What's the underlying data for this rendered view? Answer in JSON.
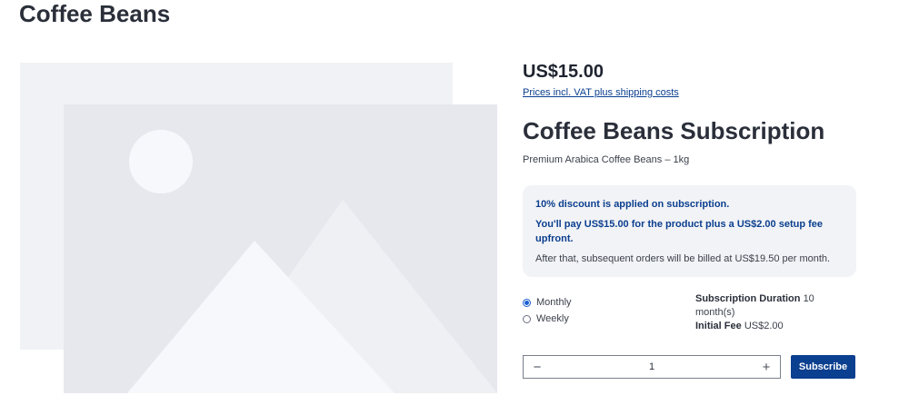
{
  "page": {
    "title": "Coffee Beans"
  },
  "product": {
    "price": "US$15.00",
    "tax_note": "Prices incl. VAT plus shipping costs",
    "name": "Coffee Beans Subscription",
    "short_description": "Premium Arabica Coffee Beans – 1kg"
  },
  "info_box": {
    "discount_text": "10% discount is applied on subscription.",
    "upfront_text": "You'll pay US$15.00 for the product plus a US$2.00 setup fee upfront.",
    "recurring_text": "After that, subsequent orders will be billed at US$19.50 per month."
  },
  "plan_options": [
    {
      "label": "Monthly",
      "selected": true
    },
    {
      "label": "Weekly",
      "selected": false
    }
  ],
  "subscription_meta": {
    "duration_label": "Subscription Duration",
    "duration_value": "10 month(s)",
    "fee_label": "Initial Fee",
    "fee_value": "US$2.00"
  },
  "quantity": {
    "decrement": "−",
    "value": "1",
    "increment": "+"
  },
  "actions": {
    "subscribe_label": "Subscribe"
  },
  "colors": {
    "accent": "#0b3f8f",
    "placeholder_back": "#f1f2f6",
    "placeholder_front": "#e6e8ed",
    "placeholder_shape": "#f7f8fb"
  },
  "icons": {
    "gallery": "image-placeholder-icon"
  }
}
